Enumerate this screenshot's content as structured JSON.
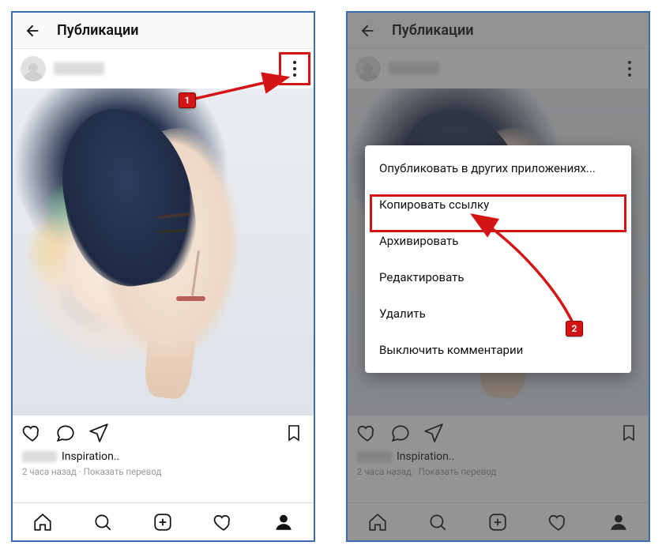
{
  "header": {
    "title": "Публикации"
  },
  "post": {
    "caption_text": "Inspiration..",
    "timestamp": "2 часа назад",
    "translate_label": "Показать перевод"
  },
  "menu": {
    "items": [
      "Опубликовать в других приложениях...",
      "Копировать ссылку",
      "Архивировать",
      "Редактировать",
      "Удалить",
      "Выключить комментарии"
    ]
  },
  "steps": {
    "s1": "1",
    "s2": "2"
  }
}
